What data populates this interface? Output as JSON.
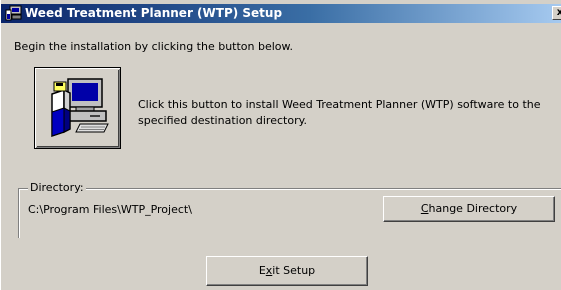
{
  "window": {
    "title": "Weed Treatment Planner (WTP) Setup",
    "close_label": "x"
  },
  "intro_text": "Begin the installation by clicking the button below.",
  "install": {
    "description": "Click this button to install Weed Treatment Planner (WTP) software to the specified destination directory."
  },
  "directory": {
    "legend": "Directory:",
    "path": "C:\\Program Files\\WTP_Project\\",
    "change_button": {
      "mnemonic": "C",
      "rest": "hange Directory"
    }
  },
  "exit_button": {
    "before": "E",
    "mnemonic": "x",
    "after": "it Setup"
  },
  "colors": {
    "face": "#d4d0c8",
    "title_start": "#0a246a",
    "title_end": "#a6caf0"
  },
  "icons": [
    "setup-computer-icon",
    "install-computer-icon",
    "close-icon"
  ]
}
